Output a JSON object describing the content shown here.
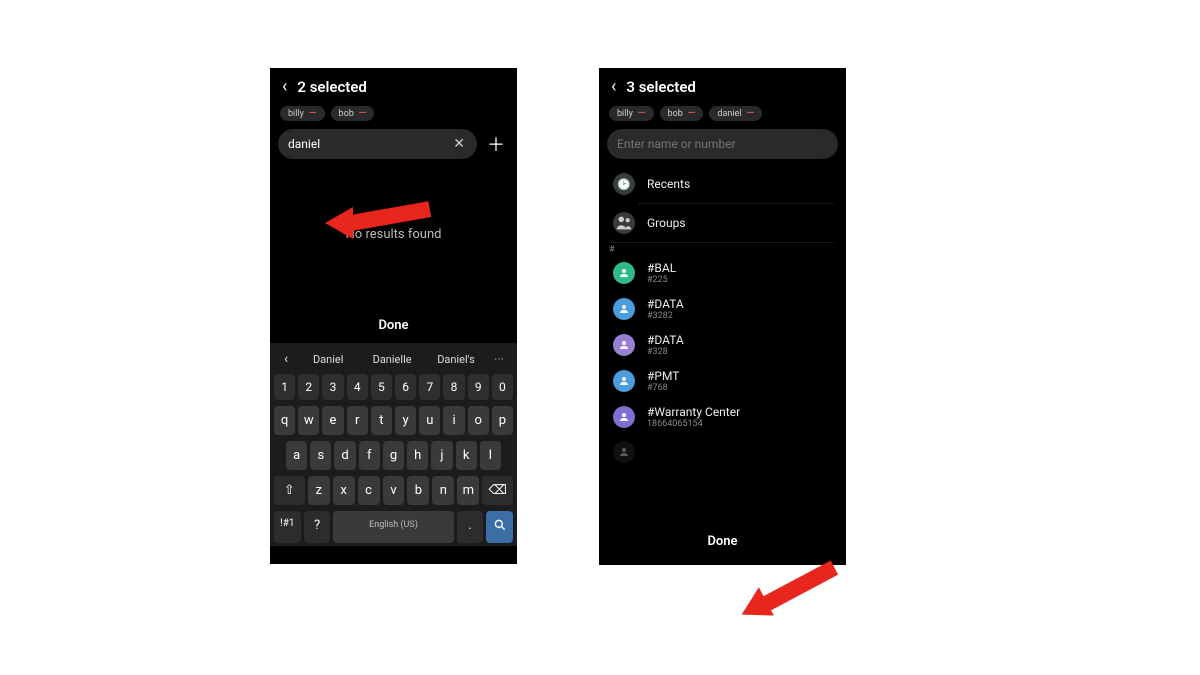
{
  "left": {
    "header_title": "2 selected",
    "chips": [
      {
        "name": "billy"
      },
      {
        "name": "bob"
      }
    ],
    "search_value": "daniel",
    "no_results": "No results found",
    "done_label": "Done",
    "suggestions": [
      "Daniel",
      "Danielle",
      "Daniel's"
    ],
    "keyboard": {
      "row_num": [
        "1",
        "2",
        "3",
        "4",
        "5",
        "6",
        "7",
        "8",
        "9",
        "0"
      ],
      "row1": [
        "q",
        "w",
        "e",
        "r",
        "t",
        "y",
        "u",
        "i",
        "o",
        "p"
      ],
      "row2": [
        "a",
        "s",
        "d",
        "f",
        "g",
        "h",
        "j",
        "k",
        "l"
      ],
      "row3_shift": "⇧",
      "row3": [
        "z",
        "x",
        "c",
        "v",
        "b",
        "n",
        "m"
      ],
      "row3_bksp": "⌫",
      "row4_sym": "!#1",
      "row4_q": "?",
      "row4_space": "English (US)",
      "row4_dot": ".",
      "row4_search": "🔍"
    }
  },
  "right": {
    "header_title": "3 selected",
    "chips": [
      {
        "name": "billy"
      },
      {
        "name": "bob"
      },
      {
        "name": "daniel"
      }
    ],
    "search_placeholder": "Enter name or number",
    "sections": {
      "recents": "Recents",
      "groups": "Groups"
    },
    "divider": "#",
    "contacts": [
      {
        "name": "#BAL",
        "sub": "#225",
        "color": "#2fb88a"
      },
      {
        "name": "#DATA",
        "sub": "#3282",
        "color": "#4a9de0"
      },
      {
        "name": "#DATA",
        "sub": "#328",
        "color": "#9a7fd1"
      },
      {
        "name": "#PMT",
        "sub": "#768",
        "color": "#4a9de0"
      },
      {
        "name": "#Warranty Center",
        "sub": "18664065154",
        "color": "#7f6fd1"
      }
    ],
    "done_label": "Done"
  }
}
